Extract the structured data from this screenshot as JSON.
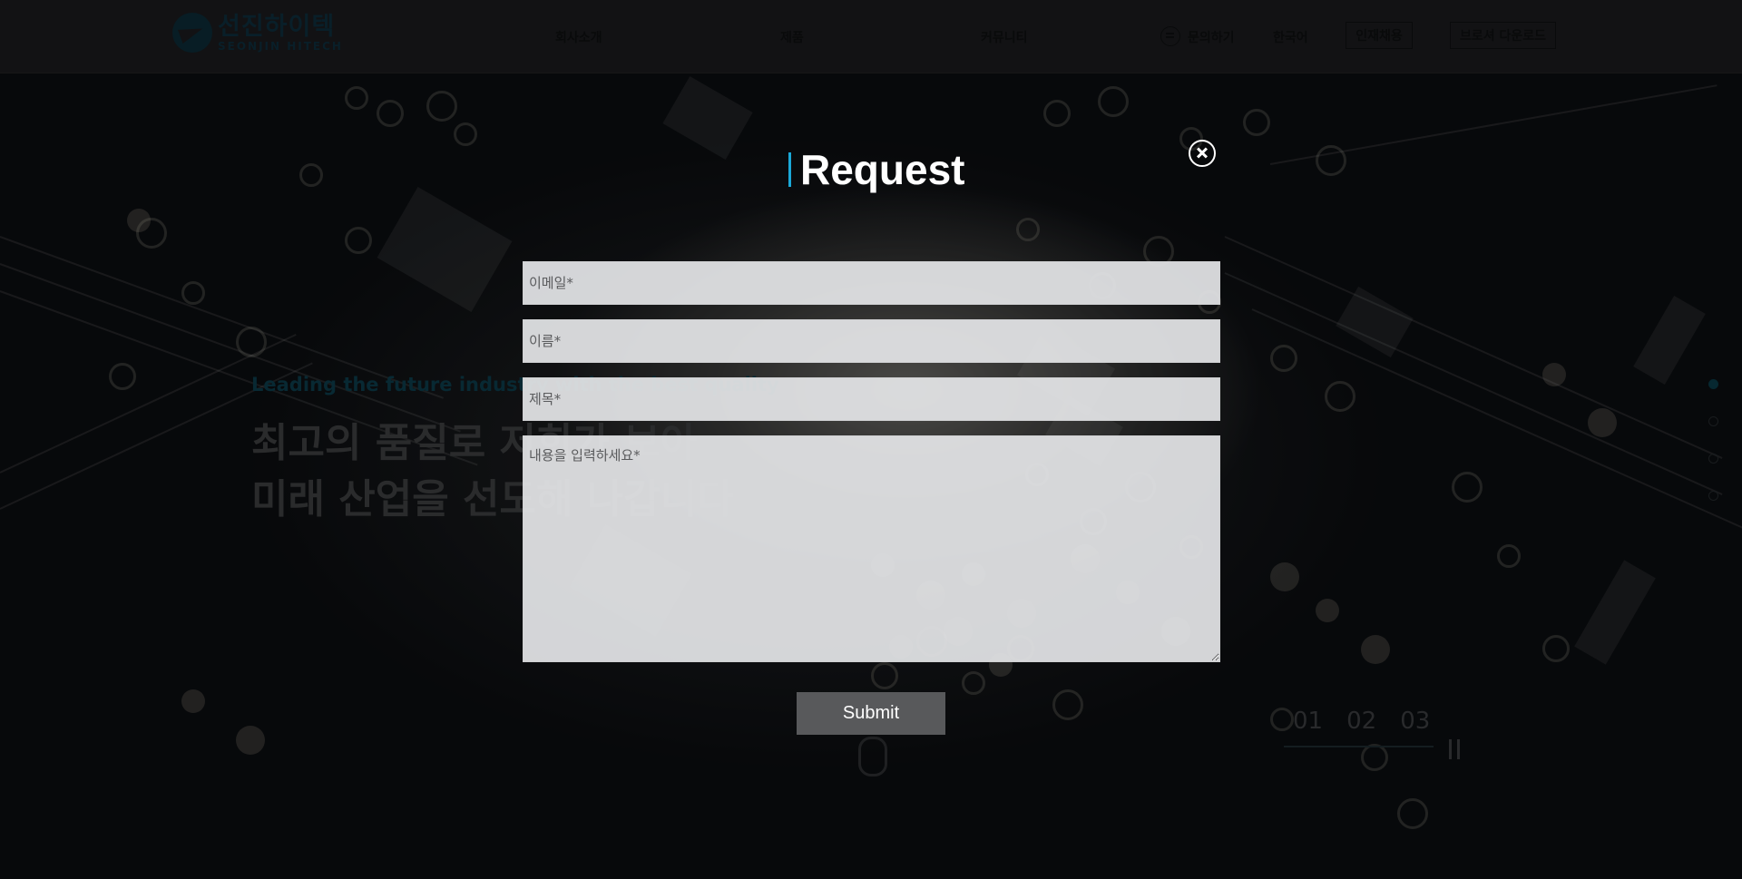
{
  "header": {
    "logo_ko": "선진하이텍",
    "logo_en": "SEONJIN HITECH",
    "nav": [
      "회사소개",
      "제품",
      "커뮤니티"
    ],
    "inquiry": "문의하기",
    "language": "한국어",
    "recruit": "인재채용",
    "brochure": "브로셔 다운로드"
  },
  "hero": {
    "subtitle": "Leading the future industry with the best quality",
    "title_line1": "최고의 품질로 저희가 보아",
    "title_line2": "미래 산업을 선도해 나갑니다",
    "slides": [
      "01",
      "02",
      "03"
    ]
  },
  "modal": {
    "title": "Request",
    "email_placeholder": "이메일*",
    "name_placeholder": "이름*",
    "subject_placeholder": "제목*",
    "message_placeholder": "내용을 입력하세요*",
    "submit": "Submit"
  },
  "colors": {
    "accent": "#1aa8d8",
    "submit_bg": "#58595b"
  }
}
